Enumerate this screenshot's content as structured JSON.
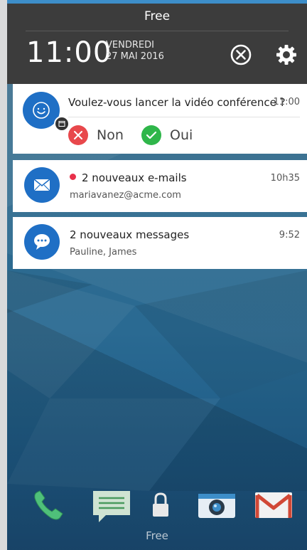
{
  "status_bar": {
    "carrier": "Free"
  },
  "quick_settings": {
    "time": "11:00",
    "day": "VENDREDI",
    "date": "27 MAI 2016",
    "icons": [
      "close-circle-icon",
      "gear-icon"
    ]
  },
  "notifications": [
    {
      "app_icon": "smiley-icon",
      "badge_icon": "calendar-icon",
      "title": "Voulez-vous lancer la vidéo conférence ?",
      "time": "11:00",
      "actions": [
        {
          "label": "Non",
          "icon": "x-icon",
          "color": "#e8484c"
        },
        {
          "label": "Oui",
          "icon": "check-icon",
          "color": "#2fb64a"
        }
      ]
    },
    {
      "app_icon": "mail-icon",
      "title": "2 nouveaux e-mails",
      "subtitle": "mariavanez@acme.com",
      "time": "10h35",
      "unread_color": "#e8304a"
    },
    {
      "app_icon": "chat-bubble-icon",
      "title": "2 nouveaux messages",
      "subtitle": "Pauline, James",
      "time": "9:52"
    }
  ],
  "dock": {
    "apps": [
      "phone-icon",
      "messages-icon",
      "lock-icon",
      "camera-icon",
      "gmail-icon"
    ],
    "carrier_label": "Free"
  },
  "colors": {
    "accent": "#1f6fc5",
    "shade": "#3c3c3c"
  }
}
